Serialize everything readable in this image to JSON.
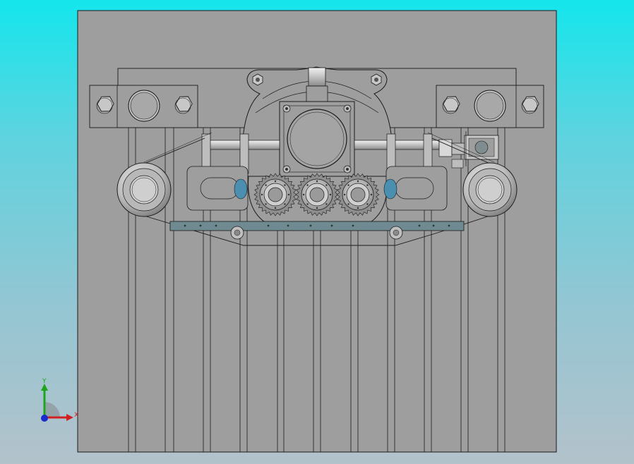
{
  "viewport": {
    "background_top": "#14e6ec",
    "background_bottom": "#b3c2cb",
    "part_fill": "#9e9e9e",
    "edge_color": "#1a1a1a",
    "shaded_metal": "#c8c8c8",
    "steel_blue": "#6f8a90",
    "bearing_blue": "#4a8fb0"
  },
  "triad": {
    "y_label": "Y",
    "x_label": "X",
    "x_color": "#d02020",
    "y_color": "#1ea51e",
    "z_color": "#1a2ccc"
  }
}
